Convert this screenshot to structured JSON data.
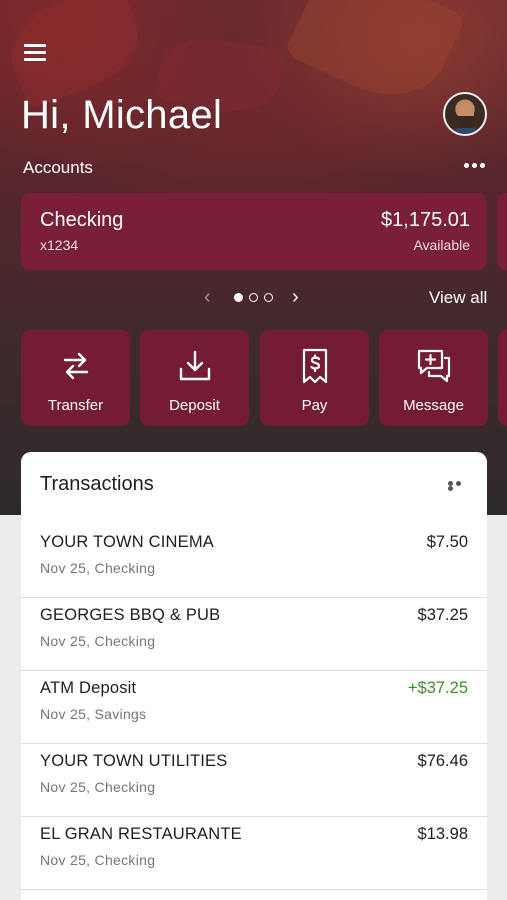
{
  "header": {
    "greeting": "Hi, Michael",
    "accounts_label": "Accounts"
  },
  "account": {
    "name": "Checking",
    "number": "x1234",
    "balance": "$1,175.01",
    "balance_label": "Available"
  },
  "pager": {
    "pages": 3,
    "current": 1,
    "view_all": "View all"
  },
  "actions": [
    {
      "label": "Transfer",
      "icon": "transfer-icon"
    },
    {
      "label": "Deposit",
      "icon": "deposit-icon"
    },
    {
      "label": "Pay",
      "icon": "pay-bill-icon"
    },
    {
      "label": "Message",
      "icon": "message-add-icon"
    }
  ],
  "transactions": {
    "title": "Transactions",
    "items": [
      {
        "name": "YOUR TOWN CINEMA",
        "sub": "Nov 25, Checking",
        "amount": "$7.50",
        "credit": false
      },
      {
        "name": "GEORGES BBQ & PUB",
        "sub": "Nov 25, Checking",
        "amount": "$37.25",
        "credit": false
      },
      {
        "name": "ATM Deposit",
        "sub": "Nov 25, Savings",
        "amount": "+$37.25",
        "credit": true
      },
      {
        "name": "YOUR TOWN UTILITIES",
        "sub": "Nov 25, Checking",
        "amount": "$76.46",
        "credit": false
      },
      {
        "name": "EL GRAN RESTAURANTE",
        "sub": "Nov 25, Checking",
        "amount": "$13.98",
        "credit": false
      }
    ]
  },
  "colors": {
    "brand": "#7a1f38",
    "credit": "#3f8f2a"
  }
}
